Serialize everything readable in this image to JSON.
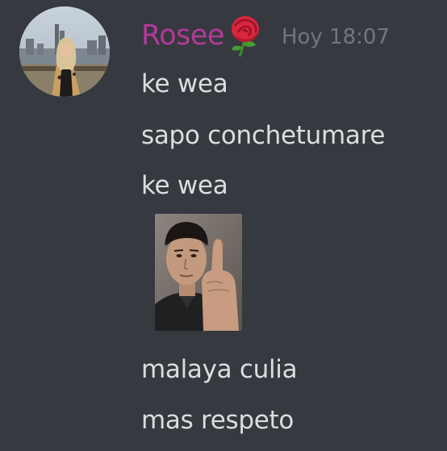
{
  "message": {
    "author": {
      "name": "Rosee",
      "badge_icon": "rose-icon",
      "color": "#b23a9a"
    },
    "timestamp": "Hoy 18:07",
    "lines": [
      "ke wea",
      "sapo conchetumare",
      "ke wea",
      "malaya culia",
      "mas respeto"
    ],
    "attachment": {
      "type": "image"
    }
  },
  "theme": {
    "background": "#36393f",
    "text": "#dcddde",
    "muted": "#72767d"
  }
}
